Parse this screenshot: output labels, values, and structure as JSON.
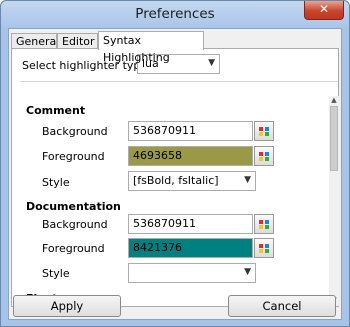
{
  "window": {
    "title": "Preferences",
    "close_glyph": "✕"
  },
  "tabs": [
    {
      "label": "General"
    },
    {
      "label": "Editor"
    },
    {
      "label": "Syntax Highlighting"
    }
  ],
  "highlighter": {
    "label": "Select highlighter type",
    "value": "lua"
  },
  "sections": {
    "comment": {
      "title": "Comment",
      "background_label": "Background",
      "background_value": "536870911",
      "foreground_label": "Foreground",
      "foreground_value": "4693658",
      "foreground_color": "#9a9a46",
      "style_label": "Style",
      "style_value": "[fsBold, fsItalic]"
    },
    "documentation": {
      "title": "Documentation",
      "background_label": "Background",
      "background_value": "536870911",
      "foreground_label": "Foreground",
      "foreground_value": "8421376",
      "foreground_color": "#008080",
      "style_label": "Style",
      "style_value": ""
    },
    "float": {
      "title": "Float"
    }
  },
  "buttons": {
    "apply": "Apply",
    "cancel": "Cancel"
  },
  "icons": {
    "dropdown": "chevron-down-icon",
    "color_picker": "palette-icon"
  }
}
